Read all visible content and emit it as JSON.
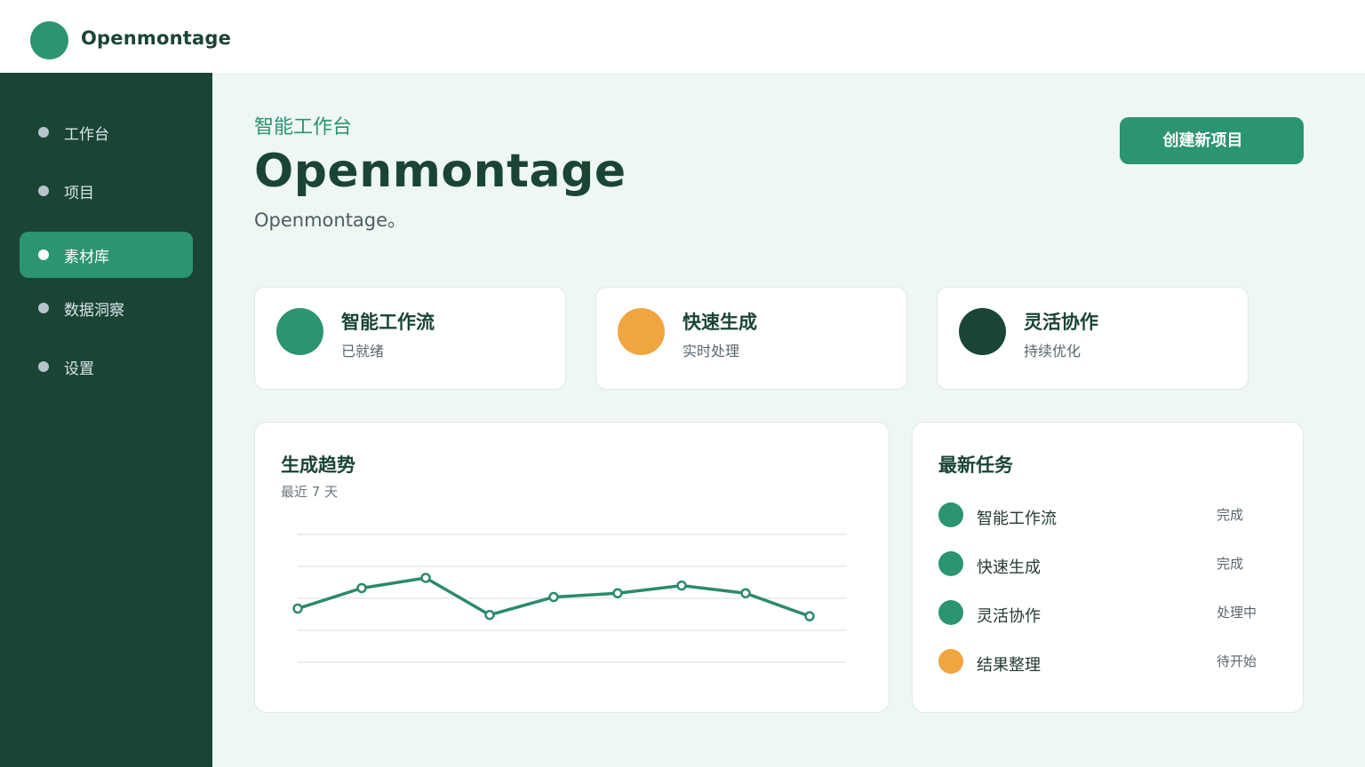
{
  "app": {
    "name": "Openmontage"
  },
  "sidebar": {
    "items": [
      {
        "label": "工作台",
        "active": false
      },
      {
        "label": "项目",
        "active": false
      },
      {
        "label": "素材库",
        "active": true
      },
      {
        "label": "数据洞察",
        "active": false
      },
      {
        "label": "设置",
        "active": false
      }
    ]
  },
  "header": {
    "eyebrow": "智能工作台",
    "title": "Openmontage",
    "subtitle": "Openmontage。",
    "create_button": "创建新项目"
  },
  "stats": [
    {
      "title": "智能工作流",
      "sub": "已就绪",
      "color": "#2b9470"
    },
    {
      "title": "快速生成",
      "sub": "实时处理",
      "color": "#f0a540"
    },
    {
      "title": "灵活协作",
      "sub": "持续优化",
      "color": "#1a4535"
    }
  ],
  "trend": {
    "title": "生成趋势",
    "subtitle": "最近 7 天"
  },
  "chart_data": {
    "type": "line",
    "title": "生成趋势",
    "subtitle": "最近 7 天",
    "x": [
      1,
      2,
      3,
      4,
      5,
      6,
      7,
      8,
      9
    ],
    "series": [
      {
        "values": [
          42,
          58,
          66,
          37,
          51,
          54,
          60,
          54,
          36
        ]
      }
    ],
    "ylim": [
      0,
      100
    ],
    "grid": true,
    "color": "#2b8a6c"
  },
  "tasks": {
    "title": "最新任务",
    "items": [
      {
        "label": "智能工作流",
        "status": "完成",
        "color": "#2b9470"
      },
      {
        "label": "快速生成",
        "status": "完成",
        "color": "#2b9470"
      },
      {
        "label": "灵活协作",
        "status": "处理中",
        "color": "#2b9470"
      },
      {
        "label": "结果整理",
        "status": "待开始",
        "color": "#f0a540"
      }
    ]
  }
}
